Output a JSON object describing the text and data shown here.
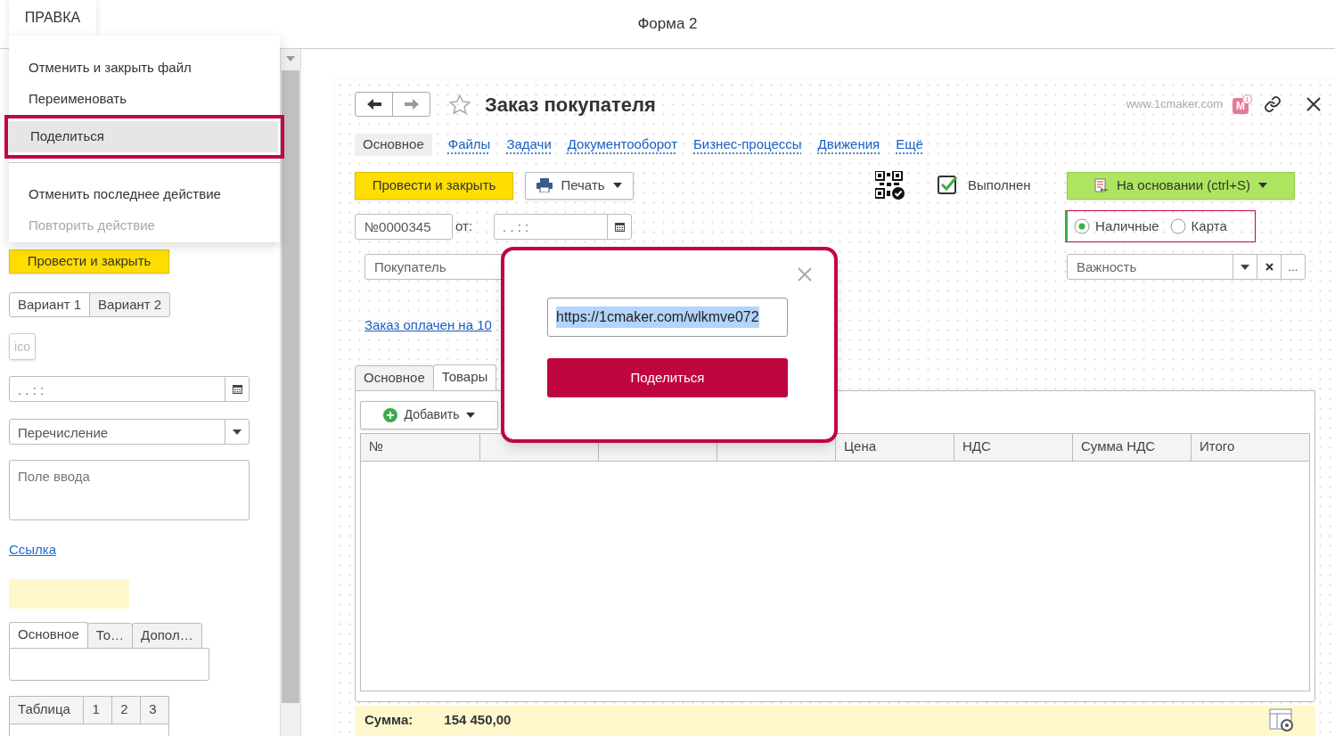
{
  "top_bar": {
    "menu_tab": "ПРАВКА",
    "title": "Форма 2"
  },
  "menu": {
    "groups": [
      {
        "items": [
          {
            "label": "Отменить и закрыть файл",
            "selected": false,
            "disabled": false
          },
          {
            "label": "Переименовать",
            "selected": false,
            "disabled": false
          },
          {
            "label": "Поделиться",
            "selected": true,
            "disabled": false
          }
        ]
      },
      {
        "items": [
          {
            "label": "Отменить последнее действие",
            "selected": false,
            "disabled": false
          },
          {
            "label": "Повторить действие",
            "selected": false,
            "disabled": true
          }
        ]
      }
    ]
  },
  "left_panel": {
    "post_button": "Провести и закрыть",
    "variants": [
      {
        "label": "Вариант 1",
        "selected": true
      },
      {
        "label": "Вариант 2",
        "selected": false
      }
    ],
    "ico_button": "ico",
    "date_field": {
      "value": ". . : :"
    },
    "enum_field": {
      "value": "Перечисление"
    },
    "text_area": {
      "placeholder": "Поле ввода"
    },
    "link": "Ссылка",
    "tabs": [
      {
        "label": "Основное",
        "selected": true
      },
      {
        "label": "То…",
        "selected": false
      },
      {
        "label": "Допол…",
        "selected": false
      }
    ],
    "table": {
      "columns": [
        "Таблица",
        "1",
        "2",
        "3"
      ]
    }
  },
  "form": {
    "title": "Заказ покупателя",
    "starred": false,
    "site": "www.1cmaker.com",
    "badge": {
      "letter": "M",
      "count": "1"
    },
    "tabs": [
      {
        "label": "Основное",
        "selected": true
      },
      {
        "label": "Файлы",
        "selected": false
      },
      {
        "label": "Задачи",
        "selected": false
      },
      {
        "label": "Документооборот",
        "selected": false
      },
      {
        "label": "Бизнес-процессы",
        "selected": false
      },
      {
        "label": "Движения",
        "selected": false
      },
      {
        "label": "Ещё",
        "selected": false
      }
    ],
    "post_button": "Провести и закрыть",
    "print_button": "Печать",
    "done": {
      "label": "Выполнен",
      "checked": true
    },
    "based_on_button": "На основании (ctrl+S)",
    "number": "№0000345",
    "from_label": "от:",
    "date": ". . : :",
    "payment": [
      {
        "label": "Наличные",
        "selected": true
      },
      {
        "label": "Карта",
        "selected": false
      }
    ],
    "customer": {
      "placeholder": "Покупатель"
    },
    "importance": {
      "placeholder": "Важность"
    },
    "more_button": "...",
    "paid_link": "Заказ оплачен на 10",
    "section_tabs": [
      {
        "label": "Основное",
        "selected": false
      },
      {
        "label": "Товары",
        "selected": true
      }
    ],
    "add_button": "Добавить",
    "table": {
      "columns": [
        {
          "kind": "label",
          "label": "№"
        },
        {
          "kind": "covered"
        },
        {
          "kind": "covered"
        },
        {
          "kind": "covered"
        },
        {
          "kind": "label",
          "label": "Цена"
        },
        {
          "kind": "label",
          "label": "НДС"
        },
        {
          "kind": "label",
          "label": "Сумма НДС"
        },
        {
          "kind": "label",
          "label": "Итого"
        }
      ]
    },
    "footer": {
      "label": "Сумма:",
      "value": "154 450,00"
    }
  },
  "popup": {
    "url": "https://1cmaker.com/wlkmve072",
    "url_selected": true,
    "button": "Поделиться"
  }
}
